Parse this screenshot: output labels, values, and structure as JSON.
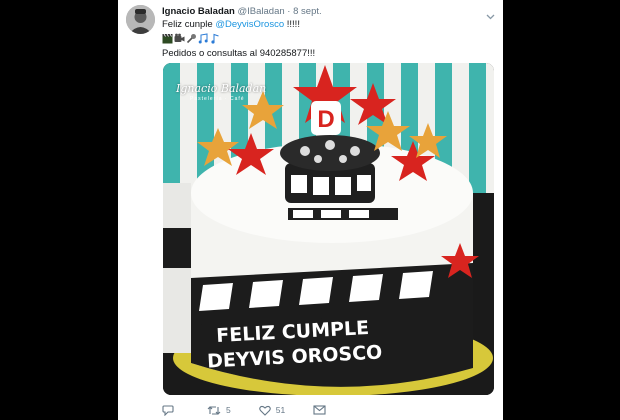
{
  "tweet": {
    "author_name": "Ignacio Baladan",
    "handle": "@IBaladan",
    "date": "8 sept.",
    "text_prefix": "Feliz cunple ",
    "mention": "@DeyvisOrosco",
    "text_suffix": " !!!!!",
    "emoji_icons": [
      "clapperboard-icon",
      "camera-icon",
      "microphone-icon",
      "music-notes-icon",
      "music-note-icon"
    ],
    "contact_line": "Pedidos o consultas al 940285877!!!",
    "photo": {
      "watermark_title": "Ignacio Baladan",
      "watermark_subtitle": "Pastelería · Café",
      "cake_letter": "D",
      "cake_lines": [
        "FELIZ CUMPLE",
        "DEYVIS OROSCO"
      ]
    },
    "actions": {
      "reply_count": "",
      "retweet_count": "5",
      "like_count": "51"
    }
  },
  "colors": {
    "link": "#1b95e0",
    "meta": "#657786",
    "stripe_teal": "#3fb4ad",
    "star_red": "#d8241f",
    "star_gold": "#e8a33a"
  }
}
